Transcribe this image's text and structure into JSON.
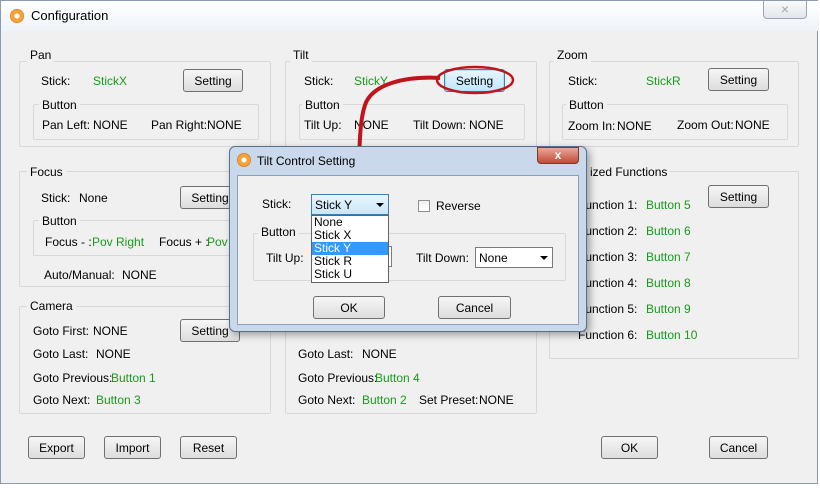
{
  "window": {
    "title": "Configuration",
    "close": "×"
  },
  "pan": {
    "title": "Pan",
    "stick_label": "Stick:",
    "stick_value": "StickX",
    "setting": "Setting",
    "button_title": "Button",
    "left_label": "Pan Left:",
    "left_value": "NONE",
    "right_label": "Pan Right:",
    "right_value": "NONE"
  },
  "tilt": {
    "title": "Tilt",
    "stick_label": "Stick:",
    "stick_value": "StickY",
    "setting": "Setting",
    "button_title": "Button",
    "up_label": "Tilt Up:",
    "up_value": "NONE",
    "down_label": "Tilt Down:",
    "down_value": "NONE"
  },
  "zoom": {
    "title": "Zoom",
    "stick_label": "Stick:",
    "stick_value": "StickR",
    "setting": "Setting",
    "button_title": "Button",
    "in_label": "Zoom In:",
    "in_value": "NONE",
    "out_label": "Zoom Out:",
    "out_value": "NONE"
  },
  "focus": {
    "title": "Focus",
    "stick_label": "Stick:",
    "stick_value": "None",
    "setting": "Setting",
    "button_title": "Button",
    "minus_label": "Focus - :",
    "minus_value": "Pov Right",
    "plus_label": "Focus + :",
    "plus_value": "Pov",
    "auto_label": "Auto/Manual:",
    "auto_value": "NONE"
  },
  "camera": {
    "title": "Camera",
    "setting": "Setting",
    "first_label": "Goto First:",
    "first_value": "NONE",
    "last_label": "Goto Last:",
    "last_value": "NONE",
    "prev_label": "Goto Previous:",
    "prev_value": "Button 1",
    "next_label": "Goto Next:",
    "next_value": "Button 3"
  },
  "preset": {
    "last_label": "Goto Last:",
    "last_value": "NONE",
    "prev_label": "Goto Previous:",
    "prev_value": "Button 4",
    "next_label": "Goto Next:",
    "next_value": "Button 2",
    "set_label": "Set Preset:",
    "set_value": "NONE"
  },
  "custom": {
    "title": "ized Functions",
    "setting": "Setting",
    "rows": [
      {
        "label": "Function 1:",
        "value": "Button 5"
      },
      {
        "label": "Function 2:",
        "value": "Button 6"
      },
      {
        "label": "Function 3:",
        "value": "Button 7"
      },
      {
        "label": "Function 4:",
        "value": "Button 8"
      },
      {
        "label": "Function 5:",
        "value": "Button 9"
      },
      {
        "label": "Function 6:",
        "value": "Button 10"
      }
    ]
  },
  "bottom": {
    "export": "Export",
    "import": "Import",
    "reset": "Reset",
    "ok": "OK",
    "cancel": "Cancel"
  },
  "dialog": {
    "title": "Tilt Control Setting",
    "close": "x",
    "stick_label": "Stick:",
    "stick_selected": "Stick Y",
    "options": [
      "None",
      "Stick X",
      "Stick Y",
      "Stick R",
      "Stick U"
    ],
    "selected_index": 2,
    "reverse_label": "Reverse",
    "reverse_checked": false,
    "button_title": "Button",
    "up_label": "Tilt Up:",
    "down_label": "Tilt Down:",
    "down_selected": "None",
    "ok": "OK",
    "cancel": "Cancel"
  },
  "colors": {
    "value_green": "#1a9a1a",
    "annotation_red": "#c0141c",
    "selection_blue": "#3399ff"
  }
}
